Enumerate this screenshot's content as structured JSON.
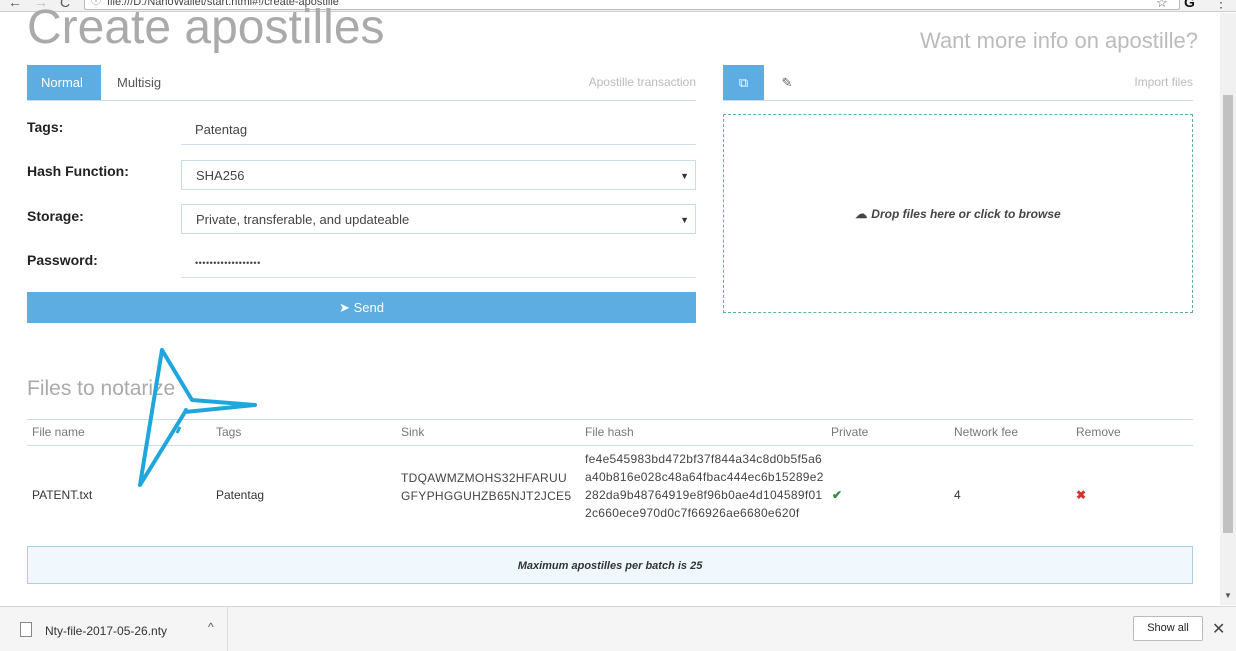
{
  "browser": {
    "url": "file:///D:/NanoWallet/start.html#!/create-apostille",
    "back": "←",
    "forward": "→",
    "reload": "C",
    "info_icon": "ⓘ",
    "star": "☆",
    "ext_icon": "G",
    "menu": "⋮"
  },
  "page": {
    "title": "Create apostilles",
    "info_link": "Want more info on apostille?"
  },
  "tabs": {
    "normal": "Normal",
    "multisig": "Multisig",
    "transaction_link": "Apostille transaction"
  },
  "form": {
    "tags_label": "Tags:",
    "tags_value": "Patentag",
    "hash_label": "Hash Function:",
    "hash_value": "SHA256",
    "storage_label": "Storage:",
    "storage_value": "Private, transferable, and updateable",
    "password_label": "Password:",
    "password_value": "••••••••••••••••••",
    "send_label": "Send"
  },
  "right_panel": {
    "tab_files_icon": "⧉",
    "tab_edit_icon": "✎",
    "import_link": "Import files",
    "dropzone_text": "Drop files here or click to browse",
    "cloud_icon": "☁"
  },
  "files": {
    "section_title": "Files to notarize",
    "headers": {
      "name": "File name",
      "tags": "Tags",
      "sink": "Sink",
      "hash": "File hash",
      "private": "Private",
      "fee": "Network fee",
      "remove": "Remove"
    },
    "rows": [
      {
        "name": "PATENT.txt",
        "tags": "Patentag",
        "sink": "TDQAWMZMOHS32HFARUUGFYPHGGUHZB65NJT2JCE5",
        "hash": "fe4e545983bd472bf37f844a34c8d0b5f5a6a40b816e028c48a64fbac444ec6b15289e2282da9b48764919e8f96b0ae4d104589f012c660ece970d0c7f66926ae6680e620f",
        "private": "✔",
        "fee": "4",
        "remove": "✖"
      }
    ],
    "limit_note": "Maximum apostilles per batch is 25"
  },
  "downloads": {
    "file_name": "Nty-file-2017-05-26.nty",
    "chevron": "^",
    "show_all": "Show all",
    "close": "✕"
  }
}
